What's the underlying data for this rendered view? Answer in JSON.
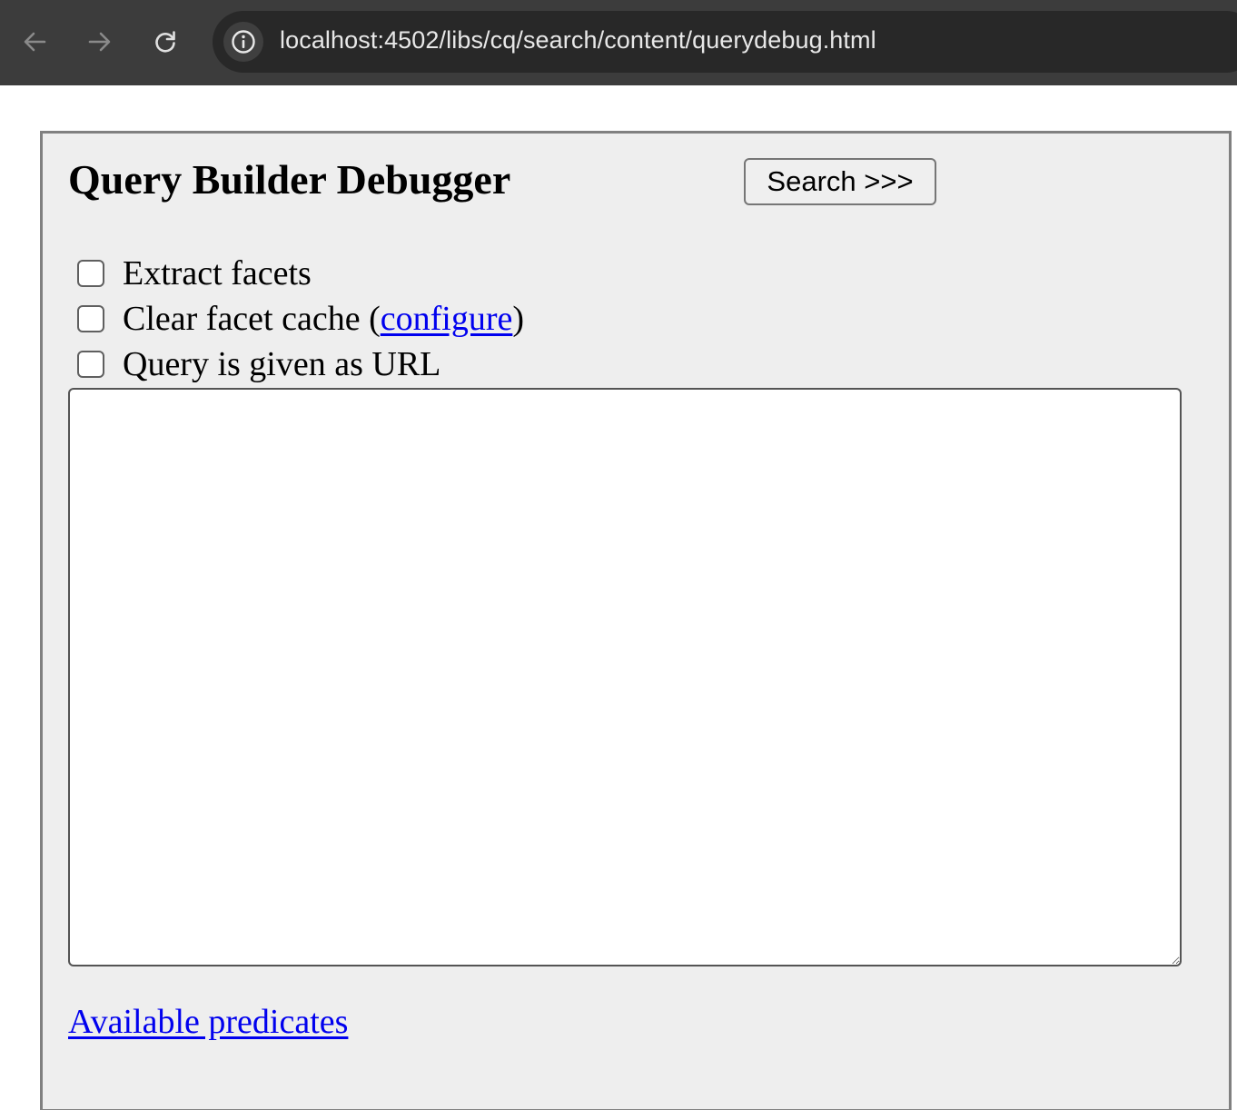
{
  "browser": {
    "url": "localhost:4502/libs/cq/search/content/querydebug.html",
    "icons": {
      "back": "arrow-left-icon",
      "forward": "arrow-right-icon",
      "reload": "reload-icon",
      "site_info": "info-icon"
    }
  },
  "page": {
    "title": "Query Builder Debugger",
    "search_button_label": "Search >>>",
    "options": [
      {
        "label": "Extract facets",
        "checked": false
      },
      {
        "label_before": "Clear facet cache (",
        "link": "configure",
        "label_after": ")",
        "checked": false
      },
      {
        "label": "Query is given as URL",
        "checked": false
      }
    ],
    "query_value": "",
    "predicates_link": "Available predicates"
  },
  "colors": {
    "chrome_bg": "#3c3c3c",
    "omnibox_bg": "#282828",
    "panel_bg": "#eeeeee",
    "panel_border": "#808080",
    "link": "#0000ee"
  }
}
